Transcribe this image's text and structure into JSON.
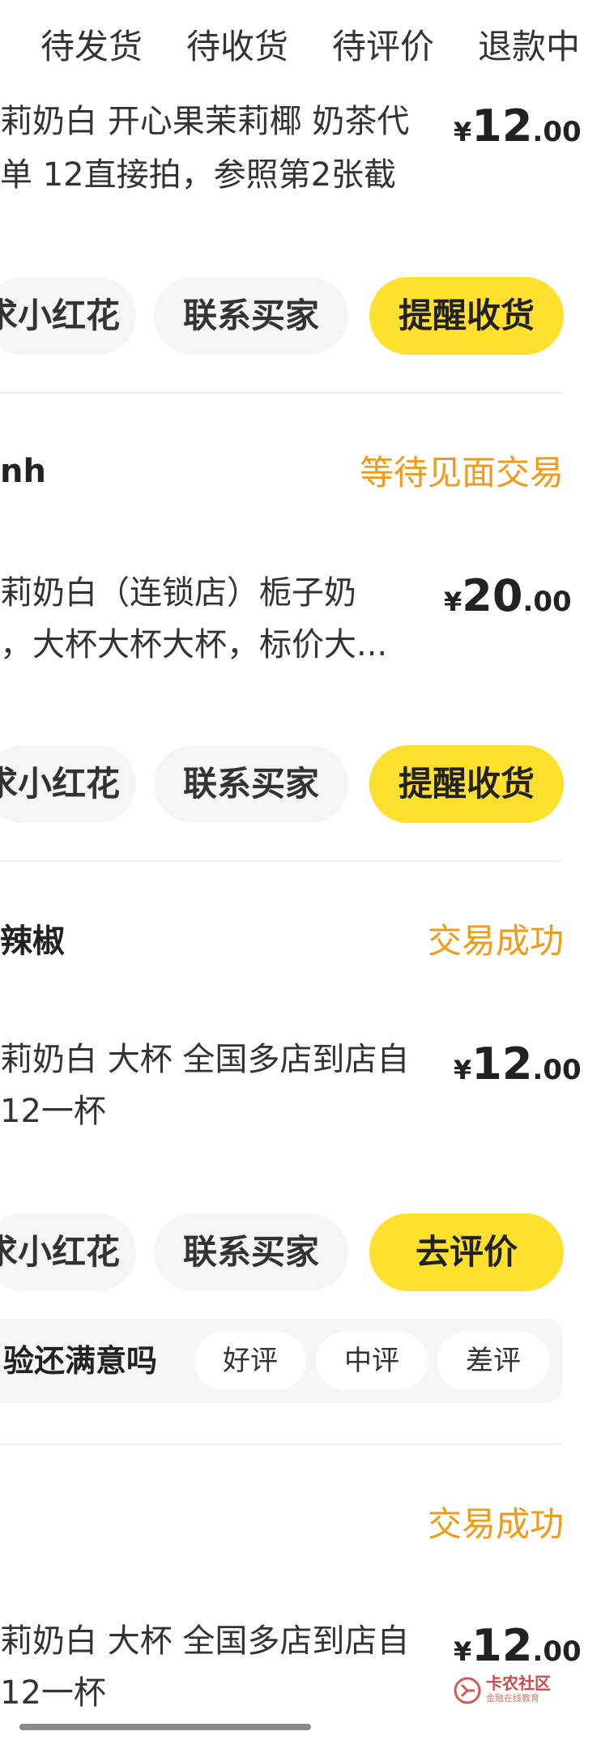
{
  "tabs": [
    "待发货",
    "待收货",
    "待评价",
    "退款中"
  ],
  "orders": [
    {
      "title_lines": [
        "莉奶白 开心果茉莉椰 奶茶代",
        "单 12直接拍，参照第2张截"
      ],
      "price": {
        "currency": "¥",
        "integer": "12",
        "decimal": ".00"
      },
      "buttons": {
        "left": "求小红花",
        "contact": "联系买家",
        "primary": "提醒收货"
      }
    },
    {
      "seller": "nh",
      "status": "等待见面交易",
      "title_lines": [
        "莉奶白（连锁店）栀子奶",
        "，大杯大杯大杯，标价大..."
      ],
      "price": {
        "currency": "¥",
        "integer": "20",
        "decimal": ".00"
      },
      "buttons": {
        "left": "求小红花",
        "contact": "联系买家",
        "primary": "提醒收货"
      }
    },
    {
      "seller": "辣椒",
      "status": "交易成功",
      "title_lines": [
        "莉奶白 大杯 全国多店到店自",
        " 12一杯"
      ],
      "price": {
        "currency": "¥",
        "integer": "12",
        "decimal": ".00"
      },
      "buttons": {
        "left": "求小红花",
        "contact": "联系买家",
        "primary": "去评价"
      },
      "rating": {
        "question": "验还满意吗",
        "options": [
          "好评",
          "中评",
          "差评"
        ]
      }
    },
    {
      "status": "交易成功",
      "title_lines": [
        "莉奶白 大杯 全国多店到店自",
        " 12一杯"
      ],
      "price": {
        "currency": "¥",
        "integer": "12",
        "decimal": ".00"
      }
    }
  ],
  "watermark": {
    "name": "卡农社区",
    "tagline": "金融在线教育"
  },
  "colors": {
    "accent_yellow": "#ffe02f",
    "status_orange": "#ef9a1a",
    "button_gray": "#f5f5f5"
  }
}
